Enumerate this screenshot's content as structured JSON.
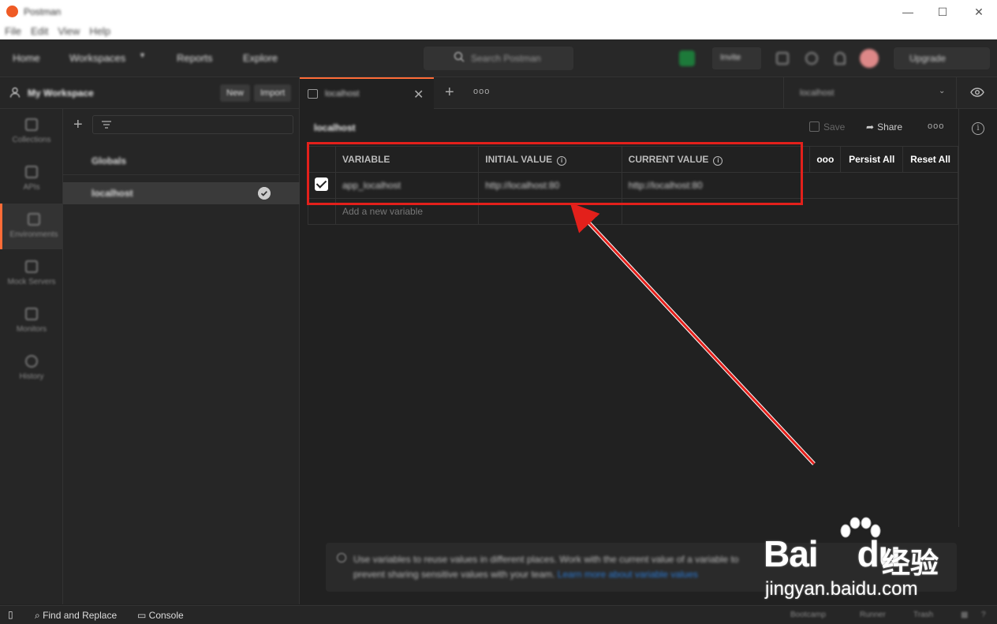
{
  "window": {
    "title": "Postman",
    "minimize_glyph": "—",
    "maximize_glyph": "☐",
    "close_glyph": "✕"
  },
  "menu": [
    "File",
    "Edit",
    "View",
    "Help"
  ],
  "topnav": {
    "items": [
      "Home",
      "Workspaces",
      "Reports",
      "Explore"
    ],
    "search_placeholder": "Search Postman",
    "invite_label": "Invite",
    "upgrade_label": "Upgrade"
  },
  "workspace": {
    "title": "My Workspace",
    "new_label": "New",
    "import_label": "Import"
  },
  "rail": [
    "Collections",
    "APIs",
    "Environments",
    "Mock Servers",
    "Monitors",
    "History"
  ],
  "environments": {
    "items": [
      "Globals",
      "localhost"
    ]
  },
  "tab": {
    "label": "localhost",
    "env_selector": "localhost"
  },
  "main": {
    "env_name": "localhost",
    "save_label": "Save",
    "share_label": "Share",
    "columns": [
      "VARIABLE",
      "INITIAL VALUE",
      "CURRENT VALUE"
    ],
    "persist_all": "Persist All",
    "reset_all": "Reset All",
    "rows": [
      {
        "variable": "app_localhost",
        "initial": "http://localhost:80",
        "current": "http://localhost:80"
      }
    ],
    "add_placeholder": "Add a new variable",
    "hint_text": "Use variables to reuse values in different places. Work with the current value of a variable to prevent sharing sensitive values with your team. ",
    "hint_link": "Learn more about variable values"
  },
  "statusbar": {
    "find_replace": "Find and Replace",
    "console": "Console",
    "bootcamp": "Bootcamp",
    "runner": "Runner",
    "trash": "Trash"
  },
  "watermark": {
    "brand": "Bai",
    "brand2": "du",
    "chinese": "经验",
    "url": "jingyan.baidu.com"
  },
  "colors": {
    "accent": "#ff6c37",
    "highlight": "#e3201b"
  }
}
